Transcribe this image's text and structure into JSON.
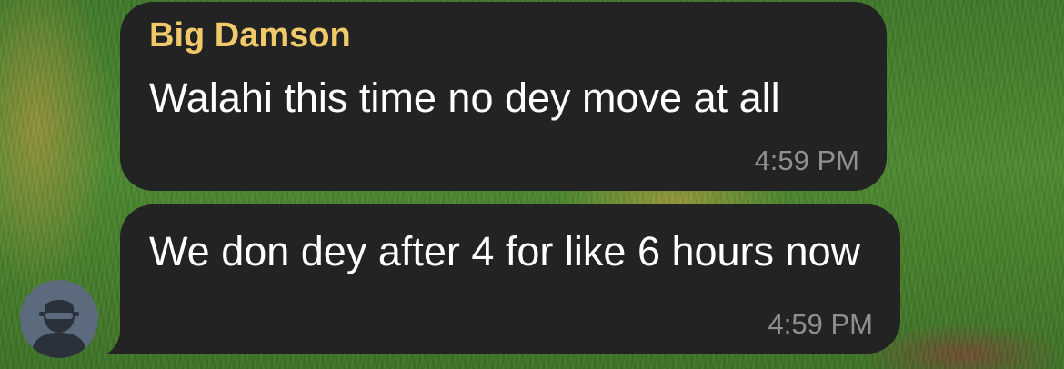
{
  "messages": [
    {
      "sender": "Big Damson",
      "text": "Walahi this time no dey move at all",
      "time": "4:59 PM"
    },
    {
      "text": "We don dey after 4 for like 6 hours now",
      "time": "4:59 PM"
    }
  ],
  "avatar": {
    "icon": "user-silhouette-icon",
    "color": "#5c6a7e"
  },
  "colors": {
    "bubble": "#232323",
    "sender_name": "#f0c96a",
    "timestamp": "#8f8f8f"
  }
}
